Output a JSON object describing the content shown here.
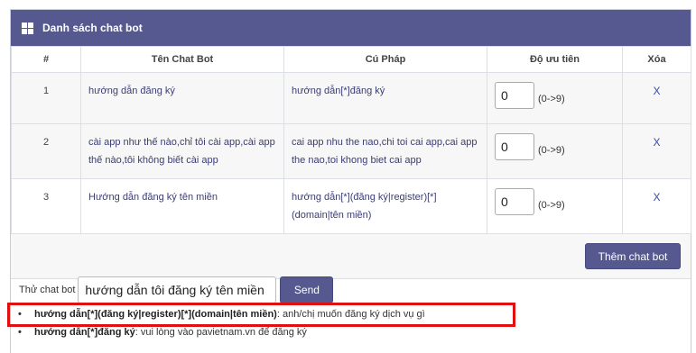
{
  "panel": {
    "title": "Danh sách chat bot"
  },
  "table": {
    "headers": [
      "#",
      "Tên Chat Bot",
      "Cú Pháp",
      "Độ ưu tiên",
      "Xóa"
    ],
    "rows": [
      {
        "index": "1",
        "name": "hướng dẫn đăng ký",
        "syntax": "hướng dẫn[*]đăng ký",
        "priority": "0",
        "priority_hint": "(0->9)",
        "delete": "X"
      },
      {
        "index": "2",
        "name": "cài app như thế nào,chỉ tôi cài app,cài app thế nào,tôi không biết cài app",
        "syntax": "cai app nhu the nao,chi toi cai app,cai app the nao,toi khong biet cai app",
        "priority": "0",
        "priority_hint": "(0->9)",
        "delete": "X"
      },
      {
        "index": "3",
        "name": "Hướng dẫn đăng ký tên miền",
        "syntax": "hướng dẫn[*](đăng ký|register)[*](domain|tên miền)",
        "priority": "0",
        "priority_hint": "(0->9)",
        "delete": "X"
      }
    ]
  },
  "add_button": "Thêm chat bot",
  "tester": {
    "label": "Thử chat bot",
    "input_value": "hướng dẫn tôi đăng ký tên miền",
    "send_button": "Send"
  },
  "results": [
    {
      "pattern": "hướng dẫn[*](đăng ký|register)[*](domain|tên miền)",
      "reply": ": anh/chị muốn đăng ký dịch vụ gì"
    },
    {
      "pattern": "hướng dẫn[*]đăng ký",
      "reply": ": vui lòng vào pavietnam.vn để đăng ký"
    }
  ],
  "colors": {
    "header": "#56598f",
    "highlight": "#e01010",
    "link": "#3a3d73"
  }
}
